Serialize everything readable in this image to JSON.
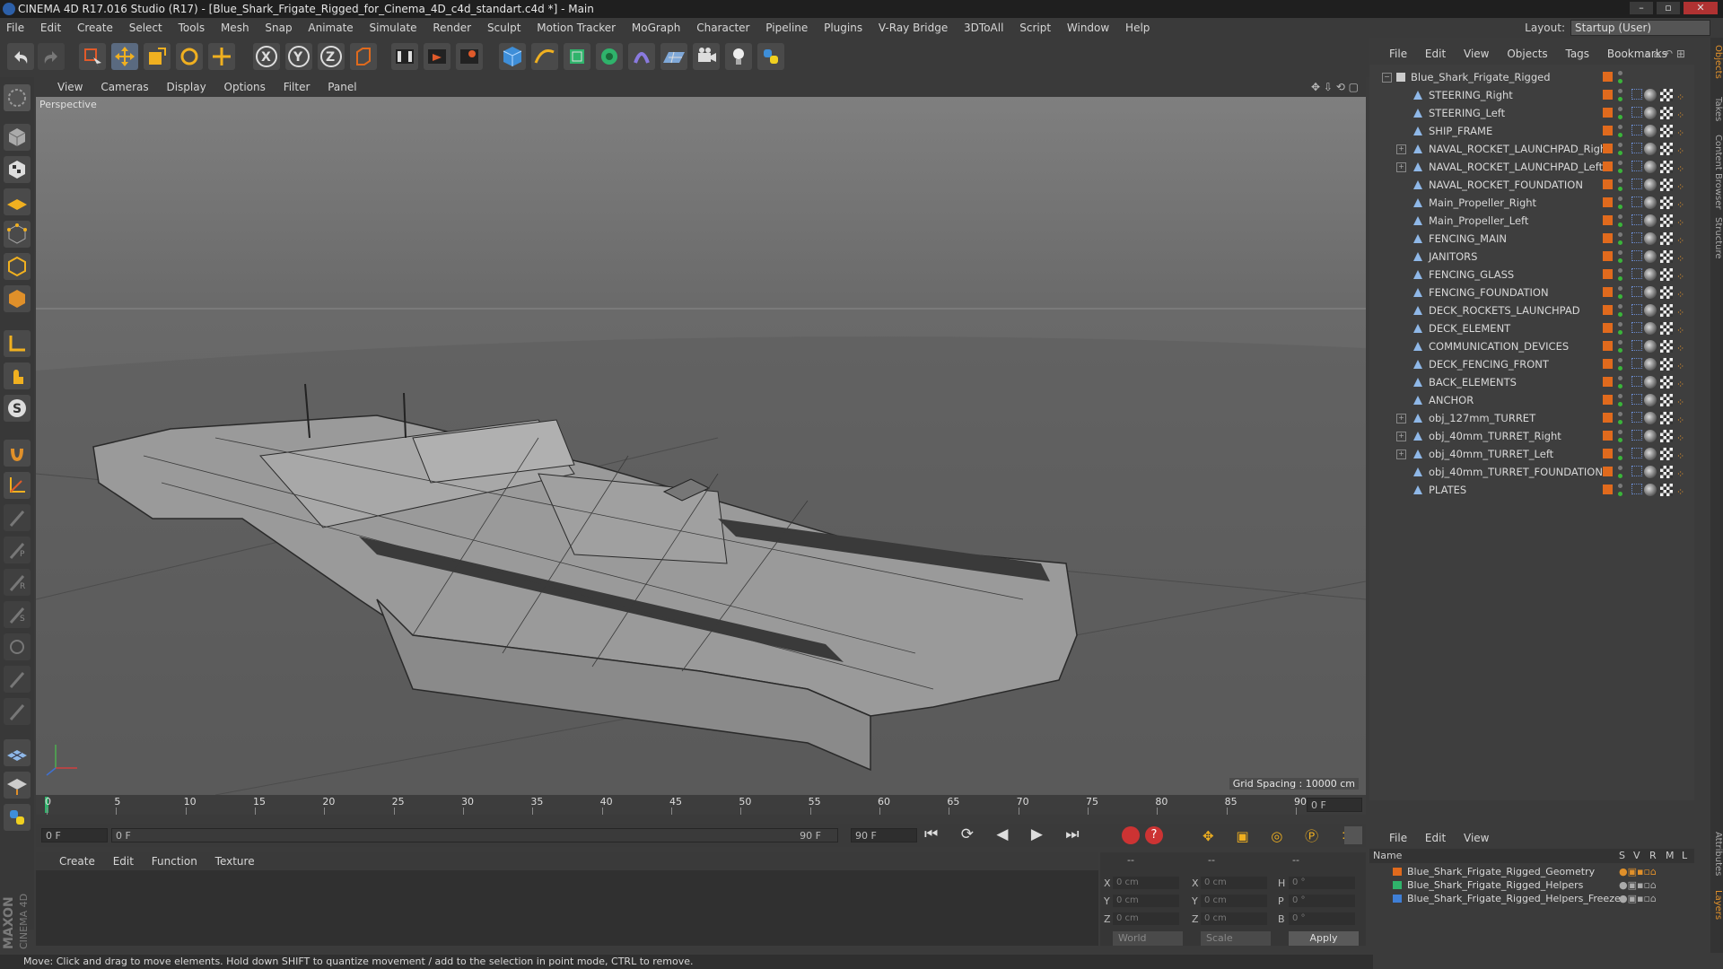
{
  "window": {
    "title": "CINEMA 4D R17.016 Studio (R17) - [Blue_Shark_Frigate_Rigged_for_Cinema_4D_c4d_standart.c4d *] - Main"
  },
  "menubar": {
    "items": [
      "File",
      "Edit",
      "Create",
      "Select",
      "Tools",
      "Mesh",
      "Snap",
      "Animate",
      "Simulate",
      "Render",
      "Sculpt",
      "Motion Tracker",
      "MoGraph",
      "Character",
      "Pipeline",
      "Plugins",
      "V-Ray Bridge",
      "3DToAll",
      "Script",
      "Window",
      "Help"
    ],
    "layout_label": "Layout:",
    "layout_value": "Startup (User)"
  },
  "viewport": {
    "menu": [
      "View",
      "Cameras",
      "Display",
      "Options",
      "Filter",
      "Panel"
    ],
    "label": "Perspective",
    "grid_spacing": "Grid Spacing : 10000 cm"
  },
  "timeline": {
    "ticks": [
      "0",
      "5",
      "10",
      "15",
      "20",
      "25",
      "30",
      "35",
      "40",
      "45",
      "50",
      "55",
      "60",
      "65",
      "70",
      "75",
      "80",
      "85",
      "90"
    ],
    "frame_end_field": "0 F",
    "current_frame": "0 F",
    "range_start": "0 F",
    "range_end_inner": "90 F",
    "range_end": "90 F"
  },
  "material": {
    "menu": [
      "Create",
      "Edit",
      "Function",
      "Texture"
    ]
  },
  "coordinates": {
    "headers": [
      "--",
      "--",
      "--"
    ],
    "rows": [
      {
        "a": "X",
        "av": "0 cm",
        "b": "X",
        "bv": "0 cm",
        "c": "H",
        "cv": "0 °"
      },
      {
        "a": "Y",
        "av": "0 cm",
        "b": "Y",
        "bv": "0 cm",
        "c": "P",
        "cv": "0 °"
      },
      {
        "a": "Z",
        "av": "0 cm",
        "b": "Z",
        "bv": "0 cm",
        "c": "B",
        "cv": "0 °"
      }
    ],
    "mode1": "World",
    "mode2": "Scale",
    "apply": "Apply"
  },
  "objects": {
    "menu": [
      "File",
      "Edit",
      "View",
      "Objects",
      "Tags",
      "Bookmarks"
    ],
    "root": "Blue_Shark_Frigate_Rigged",
    "items": [
      {
        "name": "STEERING_Right",
        "expand": false
      },
      {
        "name": "STEERING_Left",
        "expand": false
      },
      {
        "name": "SHIP_FRAME",
        "expand": false
      },
      {
        "name": "NAVAL_ROCKET_LAUNCHPAD_Right",
        "expand": true
      },
      {
        "name": "NAVAL_ROCKET_LAUNCHPAD_Left",
        "expand": true
      },
      {
        "name": "NAVAL_ROCKET_FOUNDATION",
        "expand": false
      },
      {
        "name": "Main_Propeller_Right",
        "expand": false
      },
      {
        "name": "Main_Propeller_Left",
        "expand": false
      },
      {
        "name": "FENCING_MAIN",
        "expand": false
      },
      {
        "name": "JANITORS",
        "expand": false
      },
      {
        "name": "FENCING_GLASS",
        "expand": false
      },
      {
        "name": "FENCING_FOUNDATION",
        "expand": false
      },
      {
        "name": "DECK_ROCKETS_LAUNCHPAD",
        "expand": false
      },
      {
        "name": "DECK_ELEMENT",
        "expand": false
      },
      {
        "name": "COMMUNICATION_DEVICES",
        "expand": false
      },
      {
        "name": "DECK_FENCING_FRONT",
        "expand": false
      },
      {
        "name": "BACK_ELEMENTS",
        "expand": false
      },
      {
        "name": "ANCHOR",
        "expand": false
      },
      {
        "name": "obj_127mm_TURRET",
        "expand": true
      },
      {
        "name": "obj_40mm_TURRET_Right",
        "expand": true
      },
      {
        "name": "obj_40mm_TURRET_Left",
        "expand": true
      },
      {
        "name": "obj_40mm_TURRET_FOUNDATION",
        "expand": false
      },
      {
        "name": "PLATES",
        "expand": false
      }
    ]
  },
  "layers": {
    "menu": [
      "File",
      "Edit",
      "View"
    ],
    "header": {
      "name": "Name",
      "s": "S",
      "v": "V",
      "r": "R",
      "m": "M",
      "l": "L"
    },
    "items": [
      {
        "name": "Blue_Shark_Frigate_Rigged_Geometry",
        "color": "#e06a1d"
      },
      {
        "name": "Blue_Shark_Frigate_Rigged_Helpers",
        "color": "#2fb36b"
      },
      {
        "name": "Blue_Shark_Frigate_Rigged_Helpers_Freeze",
        "color": "#3f7fd6"
      }
    ]
  },
  "right_tabs": [
    "Objects",
    "Takes",
    "Content Browser",
    "Structure",
    "Attributes",
    "Layers"
  ],
  "status": "Move: Click and drag to move elements. Hold down SHIFT to quantize movement / add to the selection in point mode, CTRL to remove.",
  "brand": {
    "line1": "MAXON",
    "line2": "CINEMA 4D"
  }
}
